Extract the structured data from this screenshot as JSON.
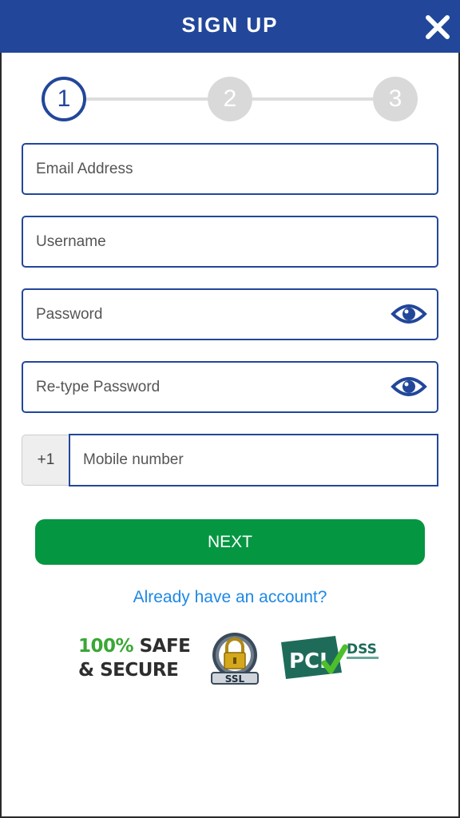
{
  "header": {
    "title": "SIGN UP",
    "close_icon": "close-icon"
  },
  "stepper": {
    "steps": [
      "1",
      "2",
      "3"
    ],
    "current_step": 1
  },
  "form": {
    "email_placeholder": "Email Address",
    "username_placeholder": "Username",
    "password_placeholder": "Password",
    "retype_password_placeholder": "Re-type Password",
    "phone_prefix": "+1",
    "mobile_placeholder": "Mobile number"
  },
  "actions": {
    "next_label": "NEXT",
    "login_link": "Already have an account?"
  },
  "badges": {
    "safe_pct": "100%",
    "safe_line1": "SAFE",
    "safe_line2": "& SECURE",
    "ssl_label": "SSL",
    "pci_label": "PCI",
    "dss_label": "DSS"
  },
  "colors": {
    "header_bg": "#22479a",
    "primary": "#22479a",
    "next_button": "#059642",
    "link": "#1e88e5",
    "step_inactive": "#d9d9d9"
  }
}
